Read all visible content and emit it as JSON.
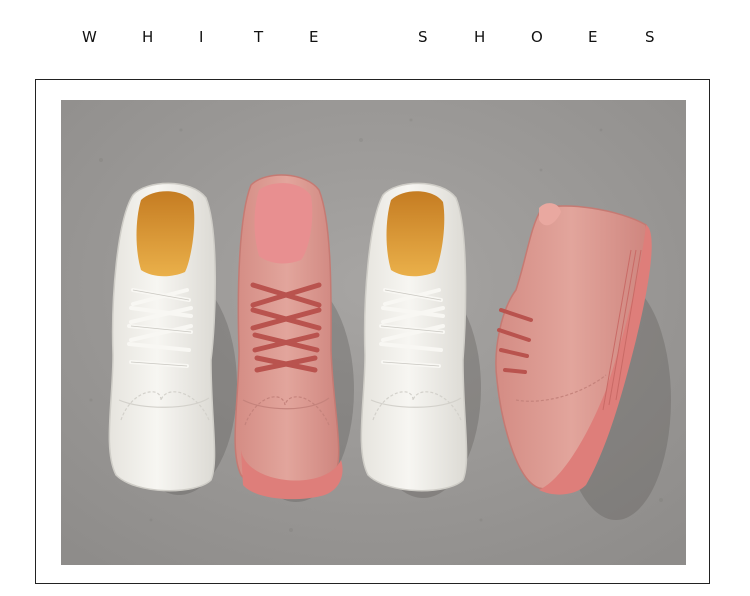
{
  "header": {
    "word1": [
      "W",
      "H",
      "I",
      "T",
      "E"
    ],
    "word2": [
      "S",
      "H",
      "O",
      "E",
      "S"
    ]
  },
  "photo": {
    "subject": "four sneakers on concrete: white, pink suede, white, pink suede side view",
    "colors": {
      "concrete": "#9a9896",
      "white_shoe": "#f1efe9",
      "insole": "#e3a238",
      "pink_shoe": "#dc9a92",
      "pink_sole": "#e07f7c"
    }
  }
}
